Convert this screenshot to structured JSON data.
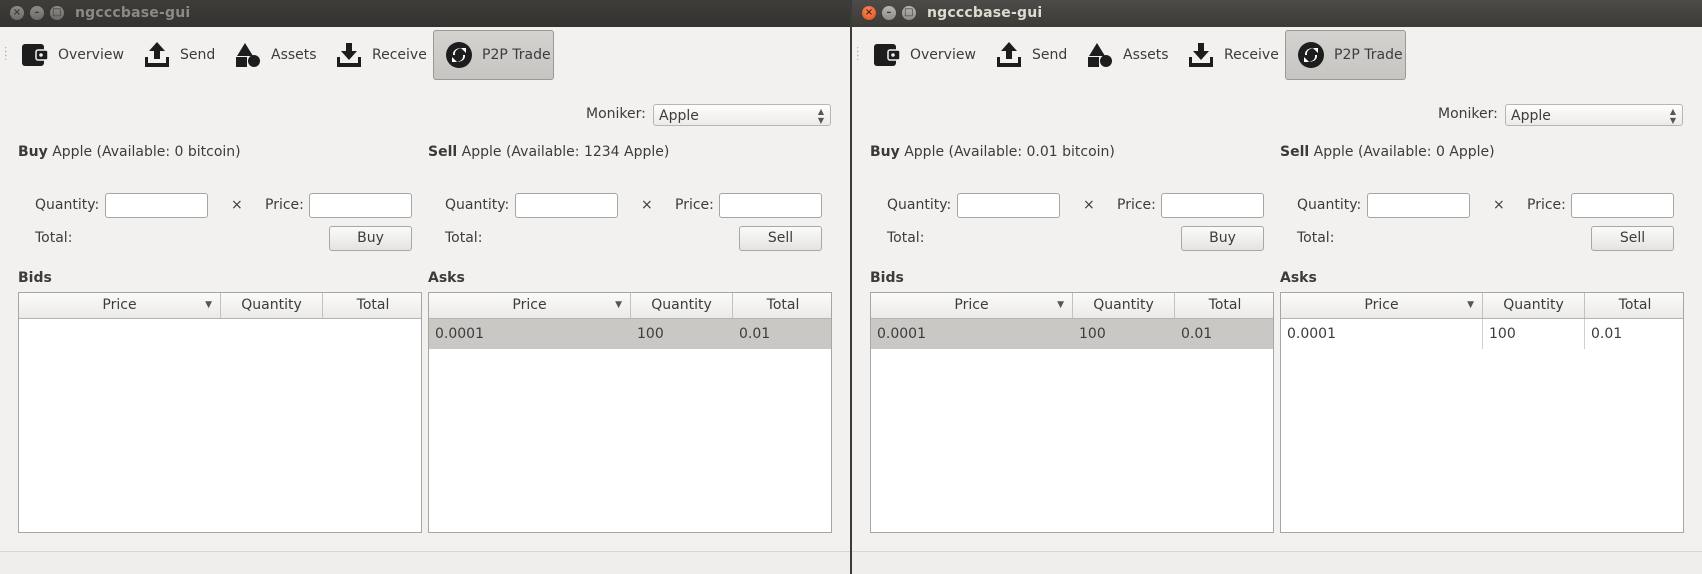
{
  "windows": [
    {
      "id": "left",
      "title": "ngcccbase-gui",
      "toolbar": [
        {
          "label": "Overview",
          "icon": "wallet-icon"
        },
        {
          "label": "Send",
          "icon": "upload-tray-icon"
        },
        {
          "label": "Assets",
          "icon": "shapes-icon"
        },
        {
          "label": "Receive",
          "icon": "download-tray-icon"
        },
        {
          "label": "P2P Trade",
          "icon": "p2p-refresh-icon",
          "checked": true
        }
      ],
      "moniker": {
        "label": "Moniker:",
        "value": "Apple"
      },
      "buy": {
        "word": "Buy",
        "rest": "Apple (Available: 0 bitcoin)",
        "quantity_label": "Quantity:",
        "times": "×",
        "price_label": "Price:",
        "total_label": "Total:",
        "button": "Buy"
      },
      "sell": {
        "word": "Sell",
        "rest": "Apple (Available: 1234 Apple)",
        "quantity_label": "Quantity:",
        "times": "×",
        "price_label": "Price:",
        "total_label": "Total:",
        "button": "Sell"
      },
      "bids": {
        "title": "Bids",
        "columns": [
          "Price",
          "Quantity",
          "Total"
        ],
        "rows": []
      },
      "asks": {
        "title": "Asks",
        "columns": [
          "Price",
          "Quantity",
          "Total"
        ],
        "rows": [
          {
            "price": "0.0001",
            "quantity": "100",
            "total": "0.01",
            "selected": true
          }
        ]
      }
    },
    {
      "id": "right",
      "title": "ngcccbase-gui",
      "toolbar": [
        {
          "label": "Overview",
          "icon": "wallet-icon"
        },
        {
          "label": "Send",
          "icon": "upload-tray-icon"
        },
        {
          "label": "Assets",
          "icon": "shapes-icon"
        },
        {
          "label": "Receive",
          "icon": "download-tray-icon"
        },
        {
          "label": "P2P Trade",
          "icon": "p2p-refresh-icon",
          "checked": true
        }
      ],
      "moniker": {
        "label": "Moniker:",
        "value": "Apple"
      },
      "buy": {
        "word": "Buy",
        "rest": "Apple (Available: 0.01 bitcoin)",
        "quantity_label": "Quantity:",
        "times": "×",
        "price_label": "Price:",
        "total_label": "Total:",
        "button": "Buy"
      },
      "sell": {
        "word": "Sell",
        "rest": "Apple (Available: 0 Apple)",
        "quantity_label": "Quantity:",
        "times": "×",
        "price_label": "Price:",
        "total_label": "Total:",
        "button": "Sell"
      },
      "bids": {
        "title": "Bids",
        "columns": [
          "Price",
          "Quantity",
          "Total"
        ],
        "rows": [
          {
            "price": "0.0001",
            "quantity": "100",
            "total": "0.01",
            "selected": true
          }
        ]
      },
      "asks": {
        "title": "Asks",
        "columns": [
          "Price",
          "Quantity",
          "Total"
        ],
        "rows": [
          {
            "price": "0.0001",
            "quantity": "100",
            "total": "0.01",
            "selected": false
          }
        ]
      }
    }
  ],
  "titlebar_buttons": {
    "close": "×",
    "minimize": "–",
    "maximize": "□"
  },
  "colors": {
    "titlebar": "#3c3b37",
    "close_active": "#df4a16",
    "window_bg": "#f2f1f0",
    "selection": "#c9c8c5"
  }
}
